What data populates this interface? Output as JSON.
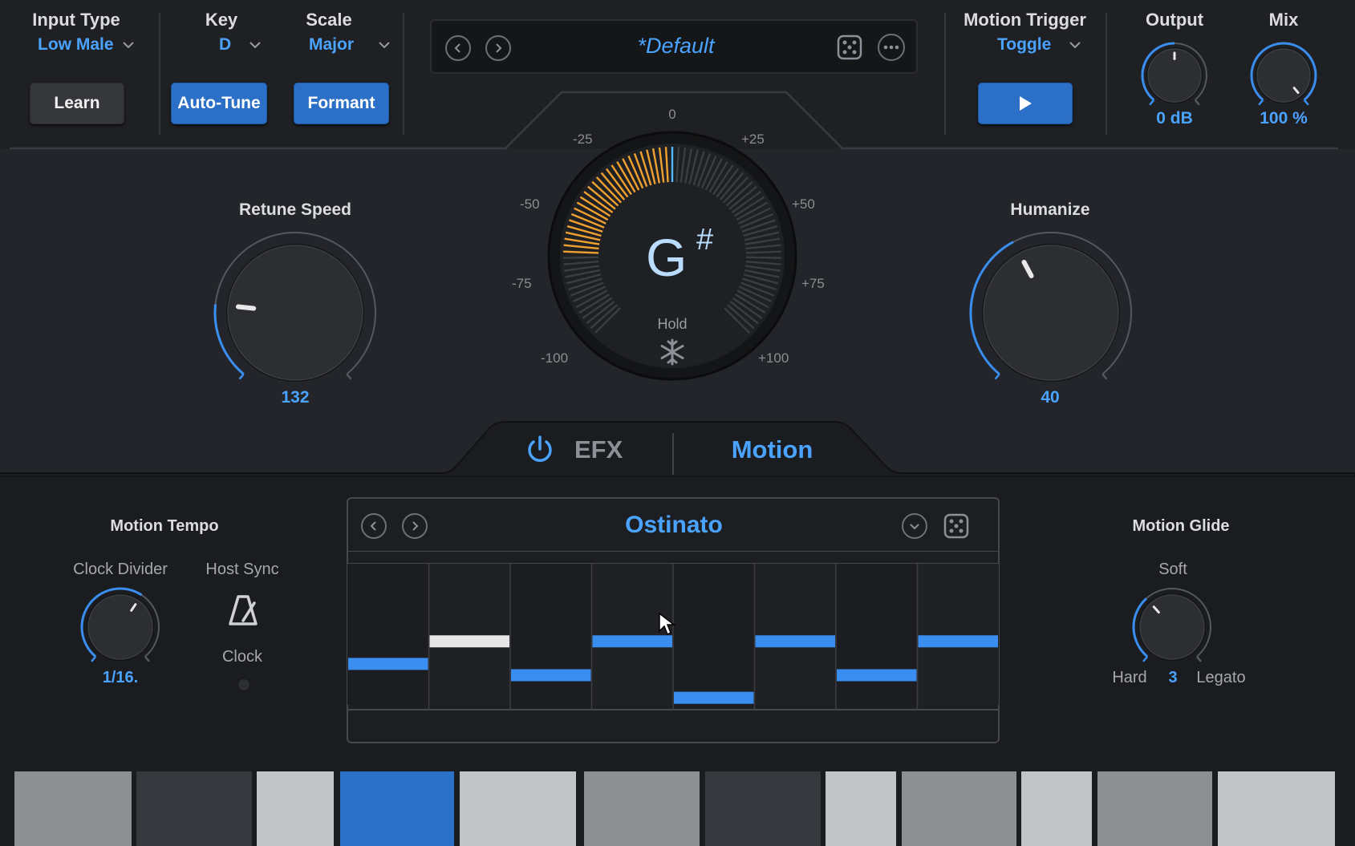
{
  "header": {
    "input_type": {
      "label": "Input Type",
      "value": "Low Male"
    },
    "key": {
      "label": "Key",
      "value": "D"
    },
    "scale": {
      "label": "Scale",
      "value": "Major"
    },
    "learn_button": "Learn",
    "autotune_button": "Auto-Tune",
    "formant_button": "Formant",
    "preset_name": "*Default",
    "motion_trigger": {
      "label": "Motion Trigger",
      "value": "Toggle"
    },
    "output": {
      "label": "Output",
      "value": "0 dB",
      "level": 0.5
    },
    "mix": {
      "label": "Mix",
      "value": "100 %",
      "level": 1.0
    }
  },
  "pitch_meter": {
    "note": "G",
    "accidental": "#",
    "hold_label": "Hold",
    "scale_labels": [
      "0",
      "-25",
      "+25",
      "-50",
      "+50",
      "-75",
      "+75",
      "-100",
      "+100"
    ],
    "cents": -65
  },
  "retune_speed": {
    "label": "Retune Speed",
    "value": "132",
    "level": 0.2
  },
  "humanize": {
    "label": "Humanize",
    "value": "40",
    "level": 0.4
  },
  "tabs": {
    "efx": "EFX",
    "motion": "Motion"
  },
  "motion_tempo": {
    "label": "Motion Tempo",
    "clock_divider_label": "Clock Divider",
    "clock_divider_value": "1/16.",
    "host_sync_label": "Host Sync",
    "clock_label": "Clock"
  },
  "motion_pattern": {
    "name": "Ostinato",
    "steps": [
      0.31,
      0.47,
      0.23,
      0.47,
      0.07,
      0.47,
      0.23,
      0.47
    ],
    "highlighted_step": 1
  },
  "motion_glide": {
    "label": "Motion Glide",
    "soft_label": "Soft",
    "hard_label": "Hard",
    "value": "3",
    "legato_label": "Legato",
    "level": 0.35
  },
  "keyboard": {
    "keys": [
      "#8e8f91",
      "#35383c",
      "#c3c4c5",
      "#2b6fc7",
      "#c3c4c5",
      "#8e8f91",
      "#35383c",
      "#c3c4c5",
      "#8e8f91",
      "#c3c4c5",
      "#8e8f91",
      "#c3c4c5"
    ]
  },
  "colors": {
    "accent": "#4aa3ff",
    "button_blue": "#2b6fc7",
    "meter_orange": "#f0a030"
  }
}
